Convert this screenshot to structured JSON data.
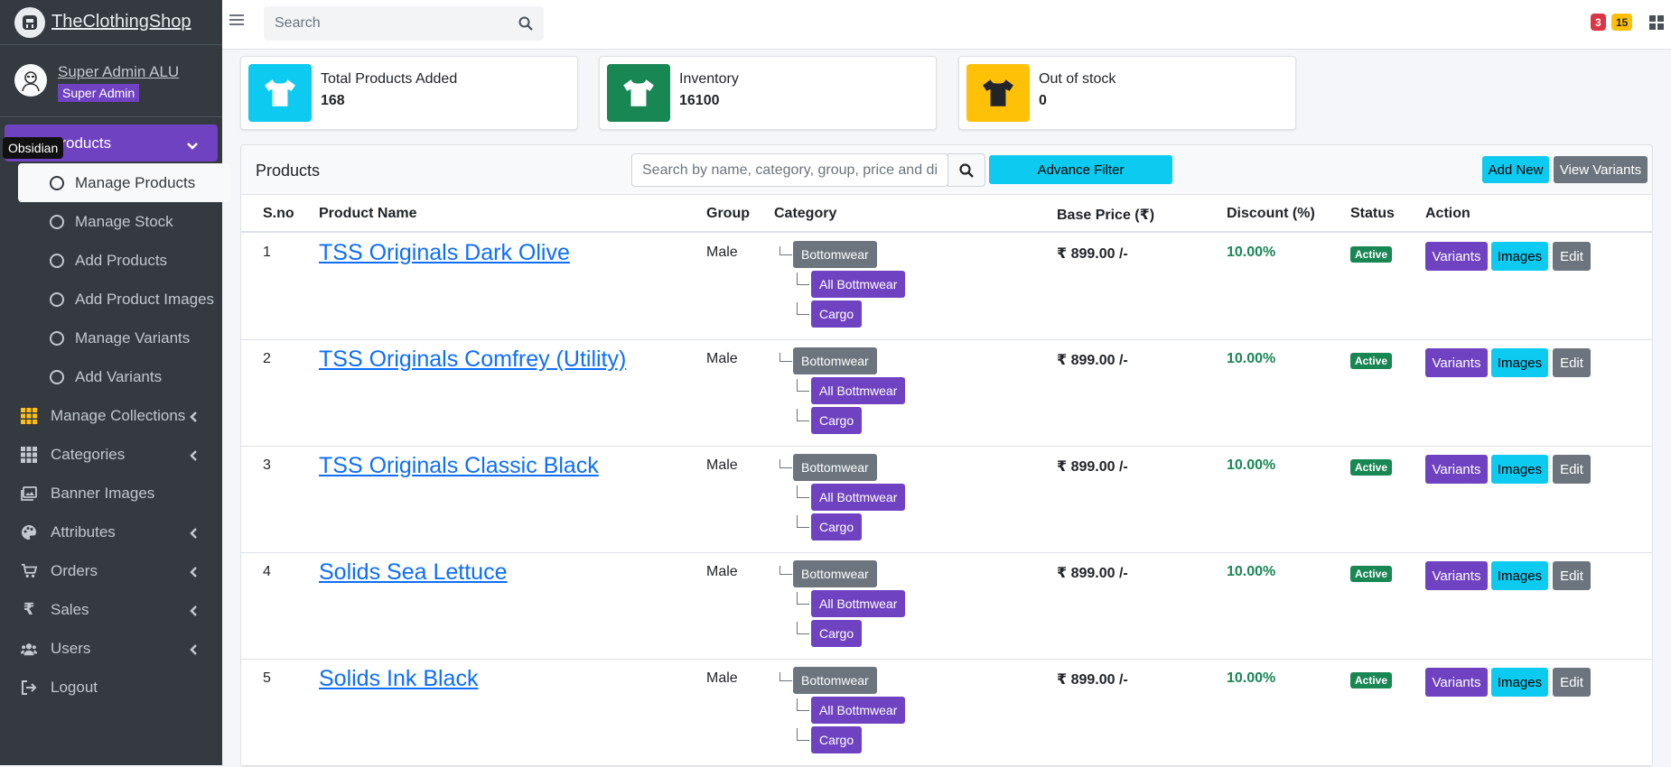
{
  "brand": {
    "name": "TheClothingShop"
  },
  "user": {
    "name": "Super Admin ALU",
    "role": "Super Admin"
  },
  "tooltip": "Obsidian",
  "nav": {
    "active_label": "Products",
    "sub_items": [
      "Manage Products",
      "Manage Stock",
      "Add Products",
      "Add Product Images",
      "Manage Variants",
      "Add Variants"
    ],
    "items": [
      {
        "label": "Manage Collections"
      },
      {
        "label": "Categories"
      },
      {
        "label": "Banner Images"
      },
      {
        "label": "Attributes"
      },
      {
        "label": "Orders"
      },
      {
        "label": "Sales"
      },
      {
        "label": "Users"
      },
      {
        "label": "Logout"
      }
    ]
  },
  "topbar": {
    "search_placeholder": "Search",
    "badge_red": "3",
    "badge_yellow": "15"
  },
  "stats": [
    {
      "label": "Total Products Added",
      "value": "168",
      "color": "#0dcaf0"
    },
    {
      "label": "Inventory",
      "value": "16100",
      "color": "#198754"
    },
    {
      "label": "Out of stock",
      "value": "0",
      "color": "#ffc107"
    }
  ],
  "panel": {
    "title": "Products",
    "search_placeholder": "Search by name, category, group, price and di",
    "advance_filter": "Advance Filter",
    "add_new": "Add New",
    "view_variants": "View Variants"
  },
  "table": {
    "headers": {
      "sno": "S.no",
      "name": "Product Name",
      "group": "Group",
      "category": "Category",
      "price": "Base Price (₹)",
      "discount": "Discount (%)",
      "status": "Status",
      "action": "Action"
    },
    "rows": [
      {
        "sno": "1",
        "name": "TSS Originals Dark Olive",
        "group": "Male",
        "cat": [
          "Bottomwear",
          "All Bottmwear",
          "Cargo"
        ],
        "price": "₹ 899.00 /-",
        "discount": "10.00%",
        "status": "Active"
      },
      {
        "sno": "2",
        "name": "TSS Originals Comfrey (Utility)",
        "group": "Male",
        "cat": [
          "Bottomwear",
          "All Bottmwear",
          "Cargo"
        ],
        "price": "₹ 899.00 /-",
        "discount": "10.00%",
        "status": "Active"
      },
      {
        "sno": "3",
        "name": "TSS Originals Classic Black",
        "group": "Male",
        "cat": [
          "Bottomwear",
          "All Bottmwear",
          "Cargo"
        ],
        "price": "₹ 899.00 /-",
        "discount": "10.00%",
        "status": "Active"
      },
      {
        "sno": "4",
        "name": "Solids Sea Lettuce",
        "group": "Male",
        "cat": [
          "Bottomwear",
          "All Bottmwear",
          "Cargo"
        ],
        "price": "₹ 899.00 /-",
        "discount": "10.00%",
        "status": "Active"
      },
      {
        "sno": "5",
        "name": "Solids Ink Black",
        "group": "Male",
        "cat": [
          "Bottomwear",
          "All Bottmwear",
          "Cargo"
        ],
        "price": "₹ 899.00 /-",
        "discount": "10.00%",
        "status": "Active"
      }
    ],
    "actions": {
      "variants": "Variants",
      "images": "Images",
      "edit": "Edit"
    }
  }
}
